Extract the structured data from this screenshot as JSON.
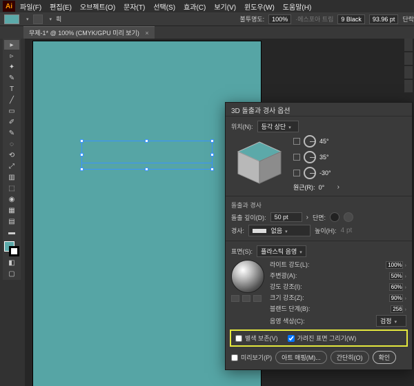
{
  "menu": {
    "items": [
      "파일(F)",
      "편집(E)",
      "오브젝트(O)",
      "문자(T)",
      "선택(S)",
      "효과(C)",
      "보기(V)",
      "윈도우(W)",
      "도움말(H)"
    ]
  },
  "optionsbar": {
    "stroke_label": "불투명도:",
    "stroke_val": "100%",
    "esstl_label": "·에스포아 트림",
    "stroke_menu": "획",
    "stroke_wt": "9 Black",
    "zoom": "93.96 pt",
    "align": "단락"
  },
  "doctab": {
    "title": "무제-1* @ 100% (CMYK/GPU 미리 보기)"
  },
  "dialog": {
    "title": "3D 돌출과 경사 옵션",
    "position_label": "위치(N):",
    "position_value": "등각 상단",
    "angles": {
      "x": "45°",
      "y": "35°",
      "z": "-30°"
    },
    "perspective_label": "원근(R):",
    "perspective_value": "0°",
    "extrude_section": "돌출과 경사",
    "depth_label": "돌출 깊이(D):",
    "depth_value": "50 pt",
    "cap_label": "단면:",
    "bevel_label": "경사:",
    "bevel_value": "없음",
    "bevel_height_label": "높이(H):",
    "bevel_height_value": "4 pt",
    "surface_label": "표면(S):",
    "surface_value": "플라스틱 음영",
    "light_intensity_label": "라이트 강도(L):",
    "light_intensity_value": "100%",
    "ambient_label": "주변광(A):",
    "ambient_value": "50%",
    "highlight_intensity_label": "강도 강조(I):",
    "highlight_intensity_value": "60%",
    "highlight_size_label": "크기 강조(Z):",
    "highlight_size_value": "90%",
    "blend_steps_label": "블랜드 단계(B):",
    "blend_steps_value": "256",
    "shade_color_label": "음영 색상(C):",
    "shade_color_value": "검정",
    "preserve_spot_label": "별색 보존(V)",
    "draw_hidden_label": "가려진 표면 그리기(W)",
    "preview_label": "미리보기(P)",
    "btn_map": "아트 매핑(M)...",
    "btn_more": "간단히(O)",
    "btn_ok": "확인"
  }
}
